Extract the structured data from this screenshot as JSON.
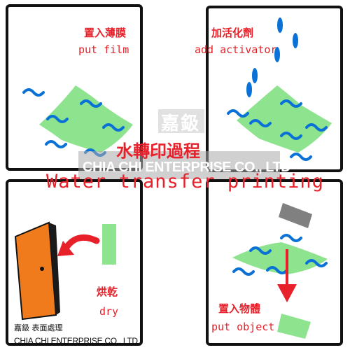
{
  "colors": {
    "border": "#111111",
    "label_red": "#e8202a",
    "film_green": "#8ee38e",
    "water_blue": "#0a72d6",
    "door_orange": "#f07b1d",
    "object_grey": "#808080"
  },
  "steps": [
    {
      "label_zh": "置入薄膜",
      "label_en": "put film"
    },
    {
      "label_zh": "加活化劑",
      "label_en": "add activator"
    },
    {
      "label_zh": "烘乾",
      "label_en": "dry"
    },
    {
      "label_zh": "置入物體",
      "label_en": "put object"
    }
  ],
  "title": {
    "zh": "水轉印過程",
    "en": "Water transfer printing"
  },
  "watermark": {
    "zh": "嘉鈒",
    "en": "CHIA CHI ENTERPRISE CO., LTD"
  },
  "footer": {
    "zh": "嘉鈒 表面處理",
    "en": "CHIA CHI ENTERPRISE CO., LTD"
  }
}
